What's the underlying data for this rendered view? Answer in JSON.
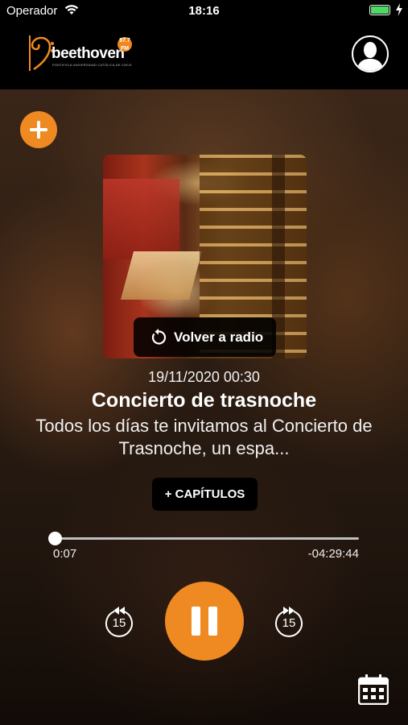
{
  "status_bar": {
    "carrier": "Operador",
    "time": "18:16",
    "battery_level": 1.0
  },
  "header": {
    "logo_text": "beethoven",
    "logo_badge": "97.7 FM",
    "logo_subtitle": "PONTIFICIA UNIVERSIDAD CATÓLICA DE CHILE",
    "profile_icon": "user-icon"
  },
  "player": {
    "add_icon": "plus-icon",
    "back_to_radio_label": "Volver a radio",
    "date": "19/11/2020 00:30",
    "title": "Concierto de trasnoche",
    "description": "Todos los días te invitamos al Concierto de Trasnoche, un espa...",
    "chapters_label": "+ CAPÍTULOS",
    "elapsed": "0:07",
    "remaining": "-04:29:44",
    "progress": 0.0,
    "rewind_seconds": "15",
    "forward_seconds": "15",
    "state": "playing"
  },
  "colors": {
    "accent": "#ef8a22"
  }
}
